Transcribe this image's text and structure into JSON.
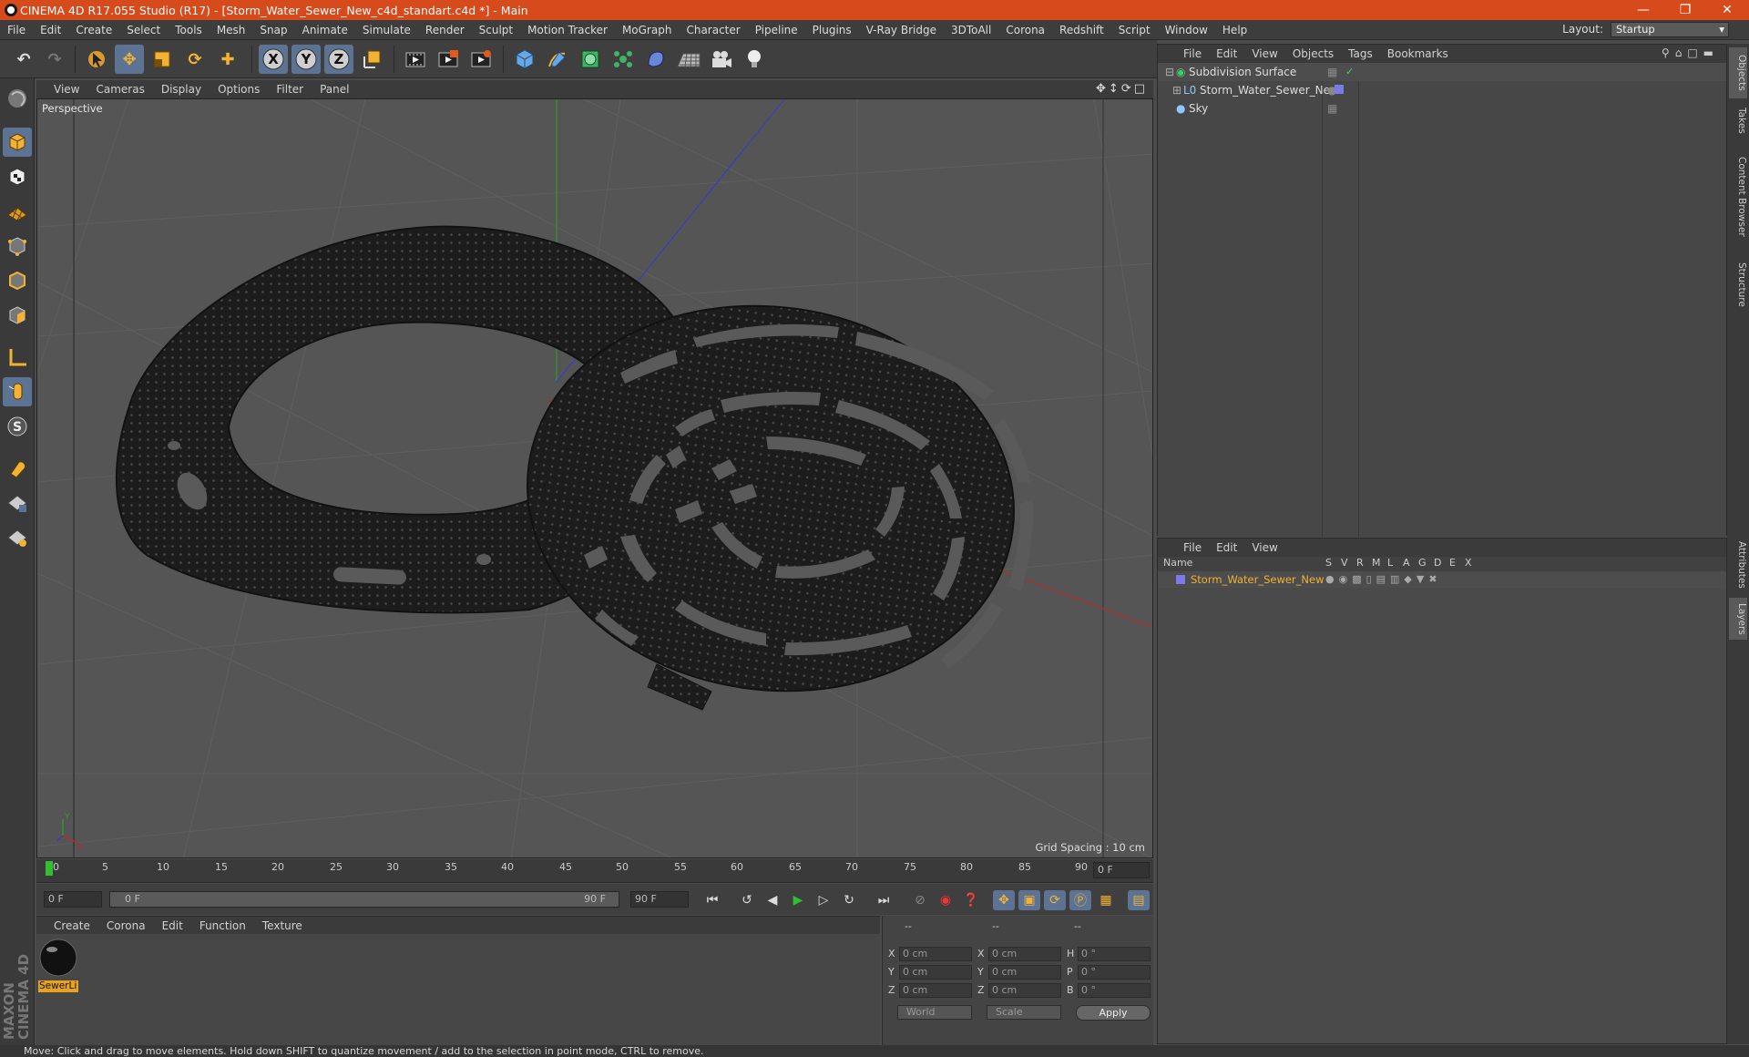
{
  "window": {
    "title": "CINEMA 4D R17.055 Studio (R17) - [Storm_Water_Sewer_New_c4d_standart.c4d *] - Main"
  },
  "menubar": {
    "items": [
      "File",
      "Edit",
      "Create",
      "Select",
      "Tools",
      "Mesh",
      "Snap",
      "Animate",
      "Simulate",
      "Render",
      "Sculpt",
      "Motion Tracker",
      "MoGraph",
      "Character",
      "Pipeline",
      "Plugins",
      "V-Ray Bridge",
      "3DToAll",
      "Corona",
      "Redshift",
      "Script",
      "Window",
      "Help"
    ],
    "layout_label": "Layout:",
    "layout_value": "Startup"
  },
  "viewport": {
    "menu": [
      "View",
      "Cameras",
      "Display",
      "Options",
      "Filter",
      "Panel"
    ],
    "label": "Perspective",
    "grid_spacing": "Grid Spacing : 10 cm"
  },
  "timeline": {
    "ticks": [
      "0",
      "5",
      "10",
      "15",
      "20",
      "25",
      "30",
      "35",
      "40",
      "45",
      "50",
      "55",
      "60",
      "65",
      "70",
      "75",
      "80",
      "85",
      "90"
    ],
    "current_frame": "0 F",
    "start_field": "0 F",
    "range_start": "0 F",
    "range_end": "90 F",
    "end_field": "90 F"
  },
  "material_manager": {
    "menu": [
      "Create",
      "Corona",
      "Edit",
      "Function",
      "Texture"
    ],
    "material_name": "SewerLi"
  },
  "coordinates": {
    "header": [
      "--",
      "--",
      "--"
    ],
    "rows": [
      {
        "a": "X",
        "av": "0 cm",
        "b": "X",
        "bv": "0 cm",
        "c": "H",
        "cv": "0 °"
      },
      {
        "a": "Y",
        "av": "0 cm",
        "b": "Y",
        "bv": "0 cm",
        "c": "P",
        "cv": "0 °"
      },
      {
        "a": "Z",
        "av": "0 cm",
        "b": "Z",
        "bv": "0 cm",
        "c": "B",
        "cv": "0 °"
      }
    ],
    "space": "World",
    "mode": "Scale",
    "apply": "Apply"
  },
  "object_manager": {
    "menu": [
      "File",
      "Edit",
      "View",
      "Objects",
      "Tags",
      "Bookmarks"
    ],
    "objects": [
      "Subdivision Surface",
      "Storm_Water_Sewer_New",
      "Sky"
    ]
  },
  "layer_manager": {
    "menu": [
      "File",
      "Edit",
      "View"
    ],
    "columns": [
      "Name",
      "S",
      "V",
      "R",
      "M",
      "L",
      "A",
      "G",
      "D",
      "E",
      "X"
    ],
    "layer_name": "Storm_Water_Sewer_New"
  },
  "side_tabs": [
    "Objects",
    "Takes",
    "Content Browser",
    "Structure",
    "Attributes",
    "Layers"
  ],
  "status": "Move: Click and drag to move elements. Hold down SHIFT to quantize movement / add to the selection in point mode, CTRL to remove.",
  "branding": "MAXON CINEMA 4D"
}
